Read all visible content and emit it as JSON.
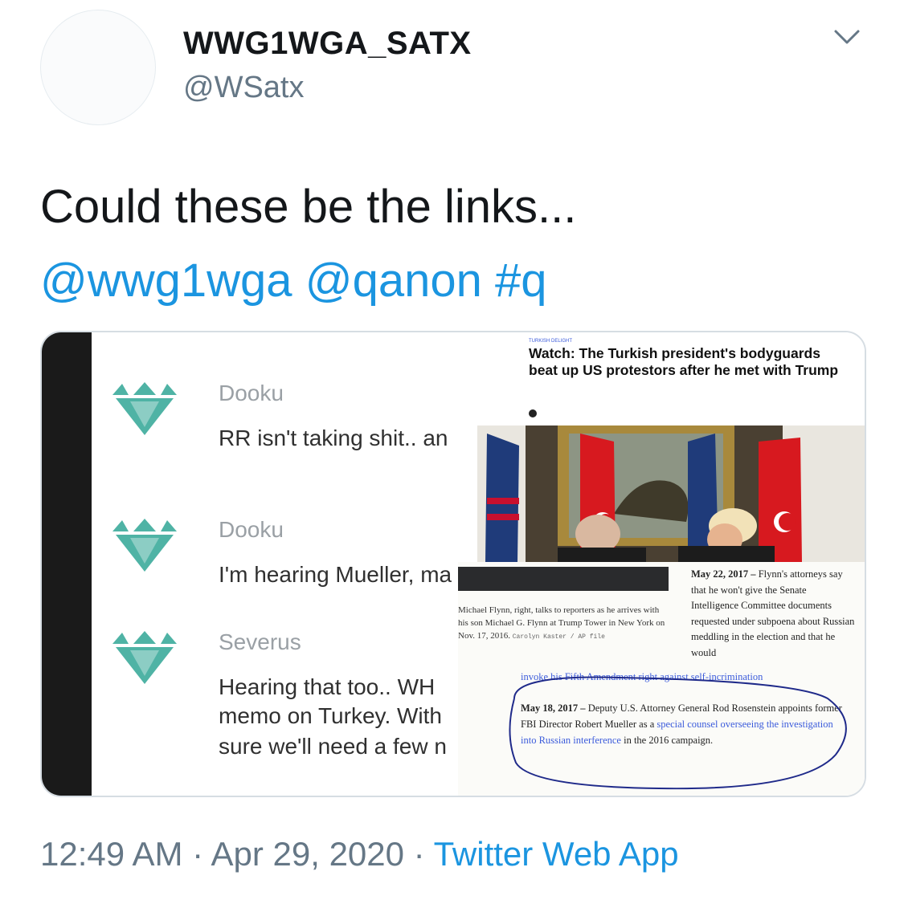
{
  "tweet": {
    "display_name": "WWG1WGA_SATX",
    "handle": "@WSatx",
    "text": "Could these be the links...",
    "mention1": "@wwg1wga",
    "mention2": "@qanon",
    "hashtag": "#q",
    "time": "12:49 AM",
    "sep1": " · ",
    "date": "Apr 29, 2020",
    "sep2": " · ",
    "source": "Twitter Web App"
  },
  "chat": [
    {
      "author": "Dooku",
      "lines": [
        "RR isn't taking shit.. an"
      ]
    },
    {
      "author": "Dooku",
      "lines": [
        "I'm hearing Mueller, ma"
      ]
    },
    {
      "author": "Severus",
      "lines": [
        "Hearing that too.. WH",
        "memo on Turkey. With",
        "sure we'll need a few n"
      ]
    }
  ],
  "article": {
    "kicker": "TURKISH DELIGHT",
    "headline": "Watch: The Turkish president's bodyguards beat up US protestors after he met with Trump"
  },
  "doc": {
    "caption": "Michael Flynn, right, talks to reporters as he arrives with his son Michael G. Flynn at Trump Tower in New York on Nov. 17, 2016.",
    "caption_credit": "Carolyn Kaster / AP file",
    "may22_label": "May 22, 2017 –",
    "may22_text": "Flynn's attorneys say that he won't give the Senate Intelligence Committee documents requested under subpoena about Russian meddling in the election and that he would",
    "invoke_link": "invoke his Fifth Amendment right against self-incrimination",
    "may18_label": "May 18, 2017 –",
    "may18_text1": "Deputy U.S. Attorney General Rod Rosenstein appoints former FBI Director Robert Mueller as a",
    "may18_link": "special counsel overseeing the investigation into Russian interference",
    "may18_text2": "in the 2016 campaign."
  },
  "colors": {
    "link": "#1b95e0",
    "gem": "#4fb3a5",
    "annotation": "#1f2a8a"
  }
}
